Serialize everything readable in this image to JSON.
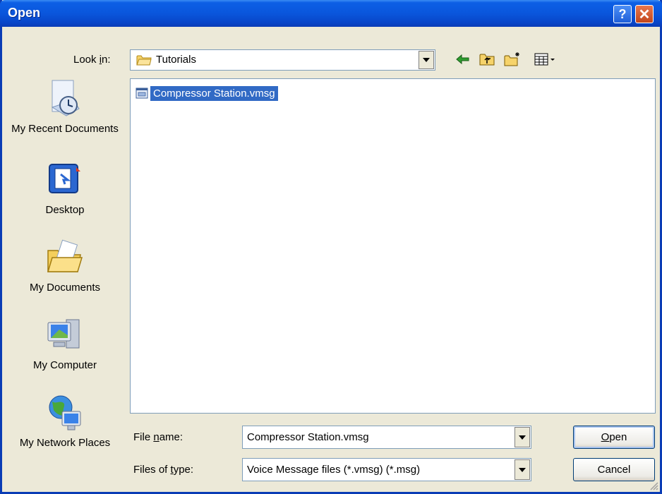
{
  "window": {
    "title": "Open",
    "help_glyph": "?",
    "close_glyph": "✕"
  },
  "look_in": {
    "label_pre": "Look ",
    "label_key": "i",
    "label_post": "n:",
    "value": "Tutorials"
  },
  "places": [
    {
      "label": "My Recent Documents",
      "icon": "recent-documents-icon"
    },
    {
      "label": "Desktop",
      "icon": "desktop-icon"
    },
    {
      "label": "My Documents",
      "icon": "my-documents-icon"
    },
    {
      "label": "My Computer",
      "icon": "my-computer-icon"
    },
    {
      "label": "My Network Places",
      "icon": "network-places-icon"
    }
  ],
  "files": [
    {
      "name": "Compressor Station.vmsg",
      "selected": true
    }
  ],
  "file_name": {
    "label_pre": "File ",
    "label_key": "n",
    "label_post": "ame:",
    "value": "Compressor Station.vmsg"
  },
  "file_type": {
    "label_pre": "Files of ",
    "label_key": "t",
    "label_post": "ype:",
    "value": "Voice Message files (*.vmsg) (*.msg)"
  },
  "buttons": {
    "open_key": "O",
    "open_rest": "pen",
    "cancel": "Cancel"
  },
  "colors": {
    "titlebar": "#0a56dc",
    "selection": "#316ac5",
    "dialog_bg": "#ece9d8"
  }
}
